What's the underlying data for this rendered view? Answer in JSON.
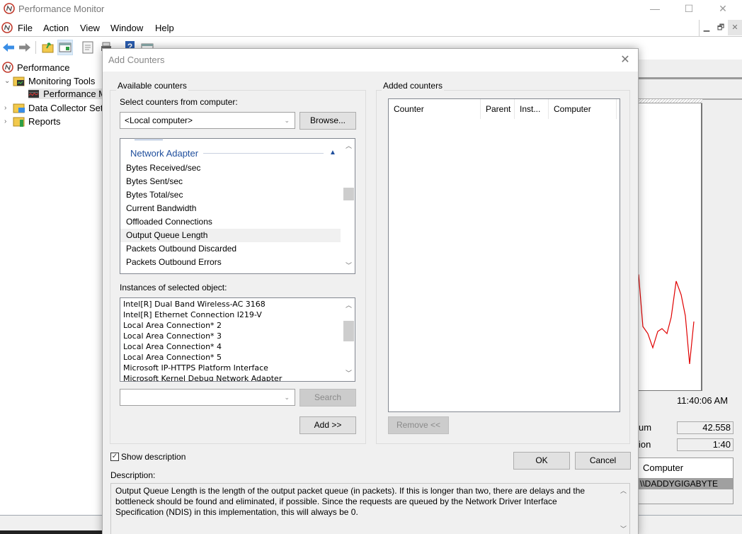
{
  "window": {
    "title": "Performance Monitor",
    "controls": {
      "minimize": "—",
      "maximize": "☐",
      "close": "✕"
    }
  },
  "menu": {
    "items": [
      "File",
      "Action",
      "View",
      "Window",
      "Help"
    ],
    "mdi_controls": {
      "minimize": "▁",
      "restore": "🗗",
      "close": "✕"
    }
  },
  "toolbar": {
    "buttons": [
      "back-icon",
      "forward-icon",
      "up-folder-icon",
      "show-hide-tree-icon",
      "properties-icon",
      "print-icon",
      "help-icon",
      "show-hide-action-pane-icon"
    ]
  },
  "tree": {
    "root": "Performance",
    "items": [
      {
        "label": "Monitoring Tools",
        "expanded": true
      },
      {
        "label": "Performance Monitor",
        "selected": true,
        "truncated": "Performance M"
      },
      {
        "label": "Data Collector Sets",
        "truncated": "Data Collector Set"
      },
      {
        "label": "Reports"
      }
    ]
  },
  "perfmon": {
    "time": "11:40:06 AM",
    "stats": [
      {
        "label": "um",
        "value": "42.558"
      },
      {
        "label": "ion",
        "value": "1:40"
      }
    ],
    "legend": {
      "header": "Computer",
      "row": "\\\\DADDYGIGABYTE"
    },
    "graph_color": "#e00000"
  },
  "dialog": {
    "title": "Add Counters",
    "close": "✕",
    "available": {
      "group_label": "Available counters",
      "select_label": "Select counters from computer:",
      "computer_value": "<Local computer>",
      "browse": "Browse...",
      "category": "Network Adapter",
      "counters": [
        "Bytes Received/sec",
        "Bytes Sent/sec",
        "Bytes Total/sec",
        "Current Bandwidth",
        "Offloaded Connections",
        "Output Queue Length",
        "Packets Outbound Discarded",
        "Packets Outbound Errors"
      ],
      "hovered_counter": "Output Queue Length",
      "instances_label": "Instances of selected object:",
      "instances": [
        "Intel[R] Dual Band Wireless-AC 3168",
        "Intel[R] Ethernet Connection I219-V",
        "Local Area Connection* 2",
        "Local Area Connection* 3",
        "Local Area Connection* 4",
        "Local Area Connection* 5",
        "Microsoft IP-HTTPS Platform Interface",
        "Microsoft Kernel Debug Network Adapter"
      ],
      "search_value": "",
      "search": "Search",
      "add": "Add >>"
    },
    "added": {
      "group_label": "Added counters",
      "columns": [
        "Counter",
        "Parent",
        "Inst...",
        "Computer"
      ],
      "rows": [],
      "remove": "Remove <<"
    },
    "show_description": {
      "label": "Show description",
      "checked": true
    },
    "description_label": "Description:",
    "description": "Output Queue Length is the length of the output packet queue (in packets). If this is longer than two, there are delays and the bottleneck should be found and eliminated, if possible. Since the requests are queued by the Network Driver Interface Specification (NDIS) in this implementation, this will always be 0.",
    "ok": "OK",
    "cancel": "Cancel"
  }
}
